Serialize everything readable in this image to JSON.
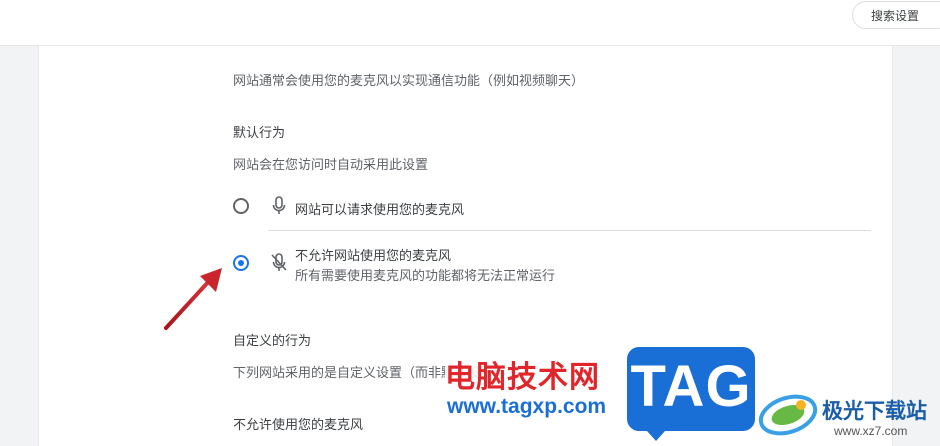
{
  "header": {
    "search_label": "搜索设置"
  },
  "content": {
    "description": "网站通常会使用您的麦克风以实现通信功能（例如视频聊天）",
    "default_behavior": {
      "heading": "默认行为",
      "subtitle": "网站会在您访问时自动采用此设置",
      "options": [
        {
          "label": "网站可以请求使用您的麦克风",
          "selected": false,
          "icon": "mic-icon"
        },
        {
          "label": "不允许网站使用您的麦克风",
          "sublabel": "所有需要使用麦克风的功能都将无法正常运行",
          "selected": true,
          "icon": "mic-off-icon"
        }
      ]
    },
    "custom_behavior": {
      "heading": "自定义的行为",
      "subtitle": "下列网站采用的是自定义设置（而非默认设置）",
      "blocked_heading": "不允许使用您的麦克风"
    }
  },
  "watermark": {
    "site_name": "电脑技术网",
    "site_url": "www.tagxp.com",
    "logo_text": "TAG",
    "brand_name": "极光下载站",
    "brand_url": "www.xz7.com"
  },
  "colors": {
    "accent": "#1a73e8",
    "arrow": "#c8262a",
    "watermark_red": "#e0262b",
    "watermark_blue": "#1a6fd6"
  }
}
